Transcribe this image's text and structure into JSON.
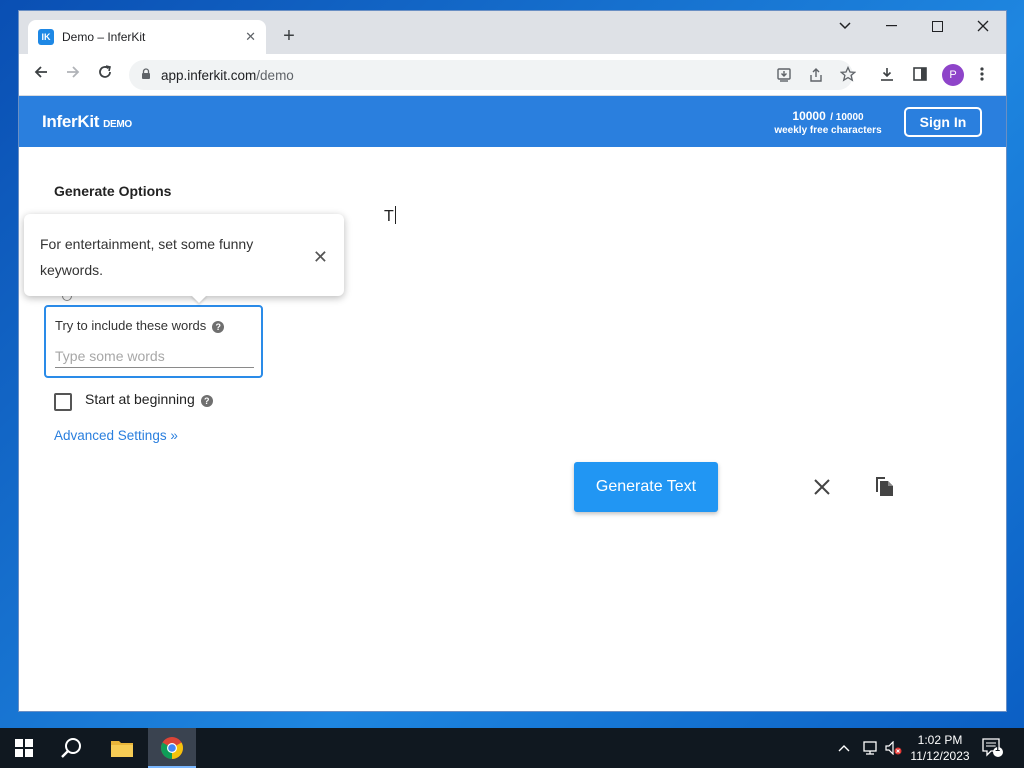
{
  "browser": {
    "tab_title": "Demo – InferKit",
    "tab_favicon": "IK",
    "url_host": "app.inferkit.com",
    "url_path": "/demo",
    "profile_initial": "P"
  },
  "header": {
    "logo": "InferKit",
    "logo_badge": "DEMO",
    "quota_used": "10000",
    "quota_max": "/ 10000",
    "quota_label": "weekly free characters",
    "signin_label": "Sign In"
  },
  "options": {
    "title": "Generate Options",
    "tooltip_text": "For entertainment, set some funny keywords.",
    "keywords_label": "Try to include these words",
    "keywords_placeholder": "Type some words",
    "keywords_value": "",
    "start_label": "Start at beginning",
    "start_checked": false,
    "advanced_label": "Advanced Settings »"
  },
  "editor": {
    "text": "T"
  },
  "actions": {
    "generate_label": "Generate Text"
  },
  "taskbar": {
    "time": "1:02 PM",
    "date": "11/12/2023",
    "notification_count": "1"
  },
  "colors": {
    "brand_blue": "#2a7fde",
    "button_blue": "#2196f3",
    "focus_blue": "#2a8be8"
  }
}
